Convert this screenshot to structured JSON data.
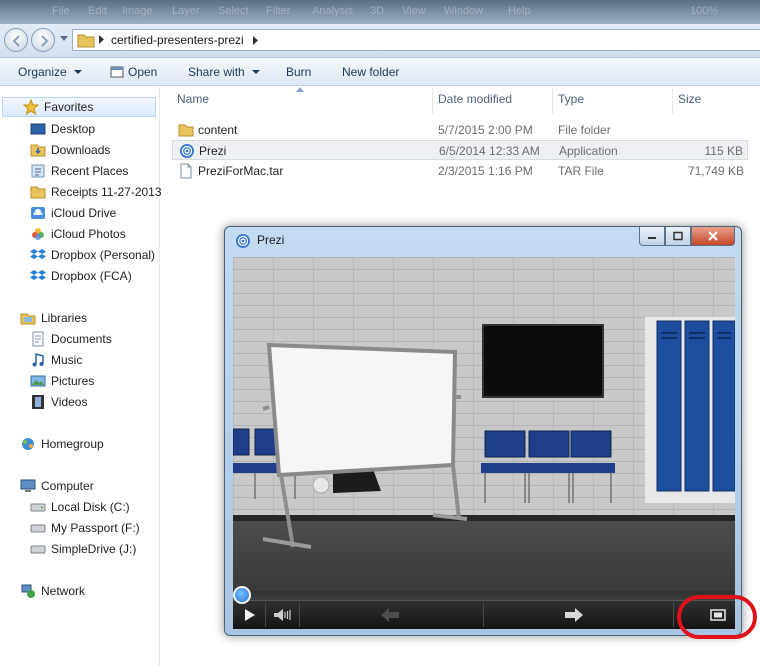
{
  "menubar": {
    "items": [
      "File",
      "Edit",
      "Image",
      "Layer",
      "Select",
      "Filter",
      "Analysis",
      "3D",
      "View",
      "Window",
      "Help"
    ],
    "zoom": "100%"
  },
  "address": {
    "path": "certified-presenters-prezi"
  },
  "toolbar": {
    "organize": "Organize",
    "open": "Open",
    "share_with": "Share with",
    "burn": "Burn",
    "new_folder": "New folder"
  },
  "nav": {
    "favorites": "Favorites",
    "favorite_items": [
      "Desktop",
      "Downloads",
      "Recent Places",
      "Receipts 11-27-2013",
      "iCloud Drive",
      "iCloud Photos",
      "Dropbox (Personal)",
      "Dropbox (FCA)"
    ],
    "libraries": "Libraries",
    "library_items": [
      "Documents",
      "Music",
      "Pictures",
      "Videos"
    ],
    "homegroup": "Homegroup",
    "computer": "Computer",
    "computer_items": [
      "Local Disk (C:)",
      "My Passport (F:)",
      "SimpleDrive (J:)"
    ],
    "network": "Network"
  },
  "files": {
    "columns": {
      "name": "Name",
      "date": "Date modified",
      "type": "Type",
      "size": "Size"
    },
    "rows": [
      {
        "name": "content",
        "date": "5/7/2015 2:00 PM",
        "type": "File folder",
        "size": ""
      },
      {
        "name": "Prezi",
        "date": "6/5/2014 12:33 AM",
        "type": "Application",
        "size": "115 KB"
      },
      {
        "name": "PreziForMac.tar",
        "date": "2/3/2015 1:16 PM",
        "type": "TAR File",
        "size": "71,749 KB"
      }
    ]
  },
  "prezi_window": {
    "title": "Prezi",
    "progress": 0
  },
  "colors": {
    "accent": "#1f73d6",
    "highlight_ring": "#e0111b",
    "locker_blue": "#1d4f9e"
  }
}
